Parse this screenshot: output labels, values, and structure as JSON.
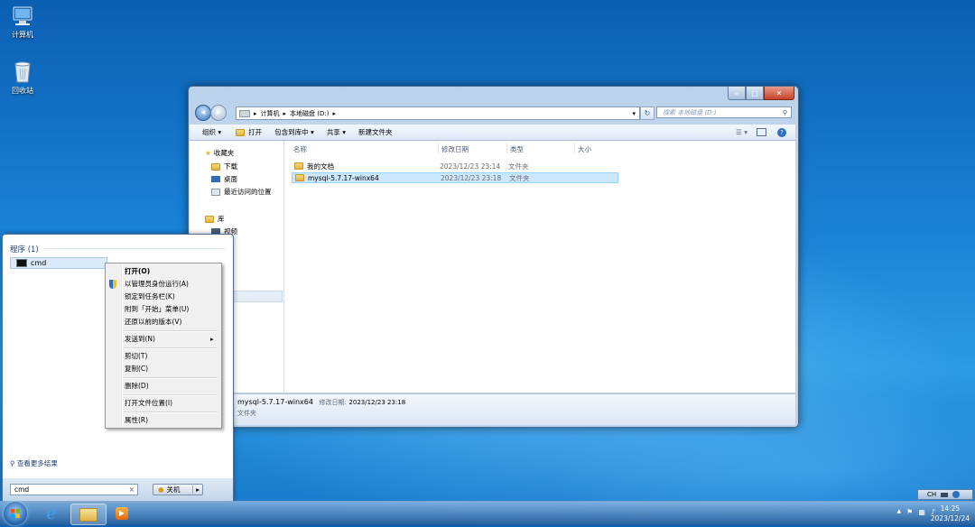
{
  "desktop": {
    "icons": [
      {
        "label": "计算机"
      },
      {
        "label": "回收站"
      }
    ]
  },
  "explorer": {
    "window_buttons": {
      "minimize": "–",
      "maximize": "□",
      "close": "✕"
    },
    "address": {
      "arrow1": "▸",
      "seg1": "计算机",
      "arrow2": "▸",
      "seg2": "本地磁盘 (D:)",
      "arrow3": "▸",
      "dropdown": "▾",
      "refresh": "↻"
    },
    "search_placeholder": "搜索 本地磁盘 (D:)",
    "toolbar": {
      "organize": "组织 ▾",
      "open": "打开",
      "include": "包含到库中 ▾",
      "share": "共享 ▾",
      "newfolder": "新建文件夹"
    },
    "nav": {
      "favorites": "收藏夹",
      "downloads": "下载",
      "desktop": "桌面",
      "recent": "最近访问的位置",
      "libraries": "库",
      "video": "视频"
    },
    "columns": {
      "name": "名称",
      "date": "修改日期",
      "type": "类型",
      "size": "大小"
    },
    "files": [
      {
        "name": "我的文档",
        "date": "2023/12/23 23:14",
        "type": "文件夹"
      },
      {
        "name": "mysql-5.7.17-winx64",
        "date": "2023/12/23 23:18",
        "type": "文件夹"
      }
    ],
    "details": {
      "name": "mysql-5.7.17-winx64",
      "date_label": "修改日期:",
      "date": "2023/12/23 23:18",
      "type": "文件夹"
    }
  },
  "start_menu": {
    "section_title": "程序 (1)",
    "result": "cmd",
    "more_results": "查看更多结果",
    "search_value": "cmd",
    "clear": "×",
    "shutdown": "关机"
  },
  "context_menu": {
    "items": [
      {
        "label": "打开(O)"
      },
      {
        "label": "以管理员身份运行(A)"
      },
      {
        "label": "锁定到任务栏(K)"
      },
      {
        "label": "附到「开始」菜单(U)"
      },
      {
        "label": "还原以前的版本(V)"
      },
      {
        "label": "发送到(N)"
      },
      {
        "label": "剪切(T)"
      },
      {
        "label": "复制(C)"
      },
      {
        "label": "删除(D)"
      },
      {
        "label": "打开文件位置(I)"
      },
      {
        "label": "属性(R)"
      }
    ],
    "submenu_arrow": "▸"
  },
  "taskbar": {
    "language": "CH",
    "clock_time": "14:25",
    "clock_date": "2023/12/24"
  }
}
